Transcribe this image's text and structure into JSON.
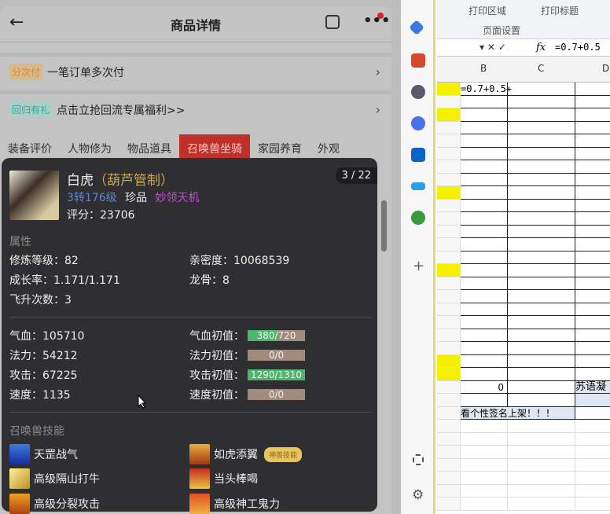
{
  "header": {
    "title": "商品详情",
    "back": "←",
    "more": "•••"
  },
  "promos": [
    {
      "tag": "分次付",
      "text": "一笔订单多次付",
      "tag_color": "#e0a050"
    },
    {
      "tag": "回归有礼",
      "text": "点击立抢回流专属福利>>",
      "tag_color": "#4ab0a0"
    }
  ],
  "tabs": [
    "装备评价",
    "人物修为",
    "物品道具",
    "召唤兽坐骑",
    "家园养育",
    "外观"
  ],
  "active_tab": "召唤兽坐骑",
  "pet": {
    "name": "白虎",
    "tag": "（葫芦管制）",
    "level": "3转176级",
    "grade": "珍品",
    "special": "妙领天机",
    "score": "评分：23706",
    "pager": "3 / 22",
    "attr_title": "属性",
    "attrs": [
      "修炼等级：82",
      "亲密度：10068539",
      "成长率：1.171/1.171",
      "龙骨：8",
      "飞升次数：3"
    ],
    "stats": [
      "气血：105710",
      "法力：54212",
      "攻击：67225",
      "速度：1135"
    ],
    "init": [
      {
        "label": "气血初值：",
        "value": "380/720",
        "fill": 0.53
      },
      {
        "label": "法力初值：",
        "value": "0/0",
        "fill": 0
      },
      {
        "label": "攻击初值：",
        "value": "1290/1310",
        "fill": 0.98
      },
      {
        "label": "速度初值：",
        "value": "0/0",
        "fill": 0
      }
    ],
    "skills_title": "召唤兽技能",
    "skills": [
      "天罡战气",
      "如虎添翼",
      "高级隔山打牛",
      "当头棒喝",
      "高级分裂攻击",
      "高级神工鬼力"
    ],
    "skill_badge": "神兽技能"
  },
  "excel": {
    "ribbon": [
      "打印区域",
      "打印标题",
      "页面设置"
    ],
    "formula": "=0.7+0.5",
    "columns": [
      "B",
      "C",
      "D"
    ],
    "cell_b1": "=0.7+0.5+",
    "cell_zero": "0",
    "cell_d": "苏语凝",
    "cell_note": "看个性签名上架！！！",
    "fx": "fx"
  }
}
